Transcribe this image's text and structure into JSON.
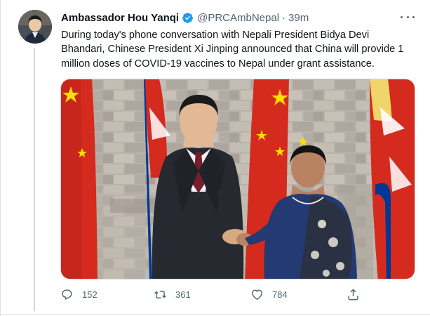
{
  "tweet": {
    "author_name": "Ambassador Hou Yanqi",
    "handle": "@PRCAmbNepal",
    "separator": "·",
    "time": "39m",
    "text": "During today's phone conversation with Nepali President Bidya Devi Bhandari, Chinese President Xi Jinping announced that China will provide 1 million doses of COVID-19 vaccines to Nepal under grant assistance."
  },
  "actions": {
    "replies": "152",
    "retweets": "361",
    "likes": "784"
  },
  "icons": {
    "verified": "verified-badge-icon",
    "more": "more-dots-icon",
    "reply": "reply-icon",
    "retweet": "retweet-icon",
    "like": "heart-icon",
    "share": "share-icon"
  },
  "colors": {
    "verified_blue": "#1d9bf0",
    "secondary_text": "#536471",
    "flag_red": "#d52b1e",
    "flag_star": "#ffde00",
    "nepal_blue": "#003893"
  }
}
